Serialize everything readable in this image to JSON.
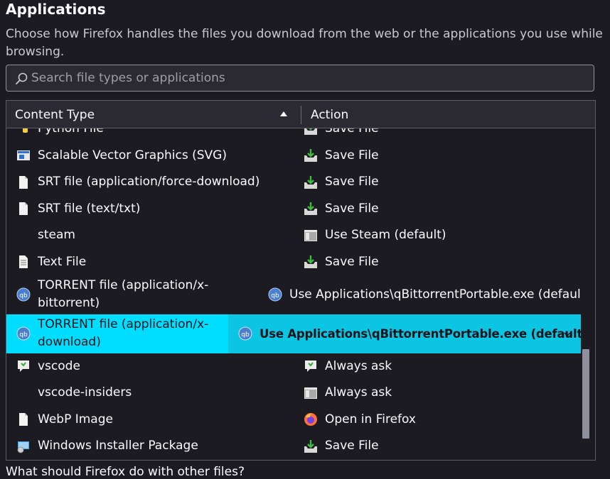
{
  "section": {
    "title": "Applications",
    "description": "Choose how Firefox handles the files you download from the web or the applications you use while browsing."
  },
  "search": {
    "placeholder": "Search file types or applications",
    "icon": "search-icon"
  },
  "table": {
    "headers": {
      "content_type": "Content Type",
      "action": "Action"
    },
    "sort": "ascending",
    "rows": [
      {
        "type": "Python File",
        "type_icon": "python-file-icon",
        "action": "Save File",
        "action_icon": "save-file-icon"
      },
      {
        "type": "Scalable Vector Graphics (SVG)",
        "type_icon": "svg-file-icon",
        "action": "Save File",
        "action_icon": "save-file-icon"
      },
      {
        "type": "SRT file (application/force-download)",
        "type_icon": "document-icon",
        "action": "Save File",
        "action_icon": "save-file-icon"
      },
      {
        "type": "SRT file (text/txt)",
        "type_icon": "document-icon",
        "action": "Save File",
        "action_icon": "save-file-icon"
      },
      {
        "type": "steam",
        "type_icon": "",
        "action": "Use Steam (default)",
        "action_icon": "application-icon"
      },
      {
        "type": "Text File",
        "type_icon": "text-file-icon",
        "action": "Save File",
        "action_icon": "save-file-icon"
      },
      {
        "type_line1": "TORRENT file (application/x-",
        "type_line2": "bittorrent)",
        "type_icon": "qbittorrent-icon",
        "action": "Use Applications\\qBittorrentPortable.exe (default)",
        "action_icon": "qbittorrent-icon"
      },
      {
        "type_line1": "TORRENT file (application/x-",
        "type_line2": "download)",
        "type_icon": "qbittorrent-icon",
        "action": "Use Applications\\qBittorrentPortable.exe (default)",
        "action_icon": "qbittorrent-icon",
        "selected": true
      },
      {
        "type": "vscode",
        "type_icon": "vscode-icon",
        "action": "Always ask",
        "action_icon": "vscode-icon"
      },
      {
        "type": "vscode-insiders",
        "type_icon": "",
        "action": "Always ask",
        "action_icon": "application-icon"
      },
      {
        "type": "WebP Image",
        "type_icon": "document-icon",
        "action": "Open in Firefox",
        "action_icon": "firefox-icon"
      },
      {
        "type": "Windows Installer Package",
        "type_icon": "installer-icon",
        "action": "Save File",
        "action_icon": "save-file-icon"
      }
    ]
  },
  "footer": {
    "question": "What should Firefox do with other files?"
  },
  "colors": {
    "background": "#1c1b22",
    "selected_row": "#00ddff",
    "selected_action": "#0bc5e3",
    "text": "#fbfbfe"
  }
}
